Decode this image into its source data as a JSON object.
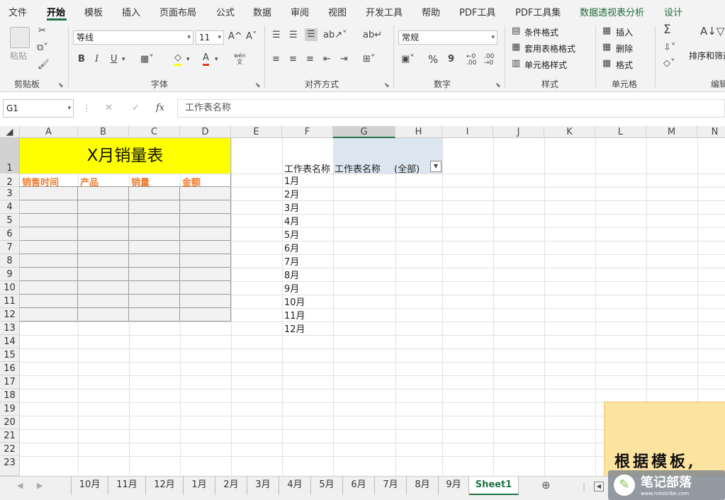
{
  "menu": {
    "items": [
      "文件",
      "开始",
      "模板",
      "插入",
      "页面布局",
      "公式",
      "数据",
      "审阅",
      "视图",
      "开发工具",
      "帮助",
      "PDF工具",
      "PDF工具集",
      "数据透视表分析",
      "设计"
    ]
  },
  "ribbon": {
    "clipboard": {
      "label": "剪贴板",
      "paste": "粘贴"
    },
    "font": {
      "label": "字体",
      "name": "等线",
      "size": "11",
      "bold": "B",
      "italic": "I",
      "underline": "U",
      "grow": "A^",
      "shrink": "Aˇ",
      "color_a": "A",
      "phonetic": "wén\n文"
    },
    "align": {
      "label": "对齐方式"
    },
    "number": {
      "label": "数字",
      "format": "常规",
      "percent": "%",
      "comma": "9"
    },
    "styles": {
      "label": "样式",
      "conditional": "条件格式",
      "table": "套用表格格式",
      "cell": "单元格样式"
    },
    "cells": {
      "label": "单元格",
      "insert": "插入",
      "delete": "删除",
      "format": "格式"
    },
    "editing": {
      "label": "编辑",
      "sort": "排序和筛选",
      "sigma": "Σ"
    }
  },
  "formula_bar": {
    "name_box": "G1",
    "fx": "fx",
    "value": "工作表名称"
  },
  "columns": [
    "A",
    "B",
    "C",
    "D",
    "E",
    "F",
    "G",
    "H",
    "I",
    "J",
    "K",
    "L",
    "M",
    "N"
  ],
  "rows": [
    "1",
    "2",
    "3",
    "4",
    "5",
    "6",
    "7",
    "8",
    "9",
    "10",
    "11",
    "12",
    "13",
    "14",
    "15",
    "16",
    "17",
    "18",
    "19",
    "20",
    "21",
    "22",
    "23"
  ],
  "sheet": {
    "title": "X月销量表",
    "headers": [
      "销售时间",
      "产品",
      "销量",
      "金额"
    ],
    "pivot_label": "工作表名称",
    "pivot_filter_label": "工作表名称",
    "pivot_filter_value": "(全部)",
    "months": [
      "1月",
      "2月",
      "3月",
      "4月",
      "5月",
      "6月",
      "7月",
      "8月",
      "9月",
      "10月",
      "11月",
      "12月"
    ]
  },
  "colors": {
    "accent": "#217346",
    "title_fill": "#ffff00",
    "header_text": "#ed7d31",
    "table_fill": "#f2f2f2",
    "pivot_fill": "#dce6f1",
    "note_fill": "#fde3a0"
  },
  "tabs": {
    "items": [
      "10月",
      "11月",
      "12月",
      "1月",
      "2月",
      "3月",
      "4月",
      "5月",
      "6月",
      "7月",
      "8月",
      "9月",
      "Sheet1"
    ],
    "active": "Sheet1"
  },
  "note": {
    "text": "根据模板,"
  },
  "watermark": {
    "title": "笔记部落",
    "url": "www.notetribe.com"
  }
}
